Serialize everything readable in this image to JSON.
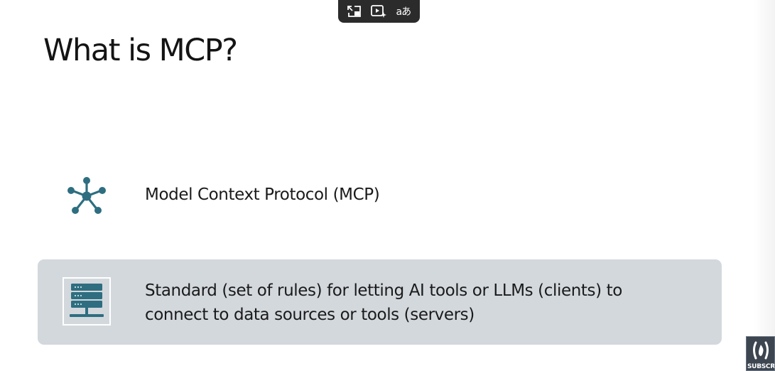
{
  "slide": {
    "title": "What is MCP?",
    "bullet": {
      "icon": "hub-network-icon",
      "text": "Model Context Protocol (MCP)"
    },
    "highlight": {
      "icon": "server-icon",
      "lines": [
        "Standard (set of rules) for letting AI tools or LLMs (clients) to",
        "connect to data sources or tools (servers)"
      ]
    }
  },
  "overlay_toolbar": {
    "buttons": [
      {
        "name": "exit-picture-in-picture-button",
        "icon": "pip-exit-icon"
      },
      {
        "name": "video-assistant-button",
        "icon": "video-sparkle-icon"
      },
      {
        "name": "translate-button",
        "icon": "translate-icon",
        "glyph": "aあ"
      }
    ]
  },
  "subscribe_badge": {
    "icon": "freecodecamp-logo-icon",
    "label": "SUBSCRIBE"
  },
  "colors": {
    "accent_teal": "#2e6e80",
    "card_bg": "#d3d8dd",
    "title_text": "#141414",
    "toolbar_bg": "#2b2b2b",
    "badge_bg": "#3c4550"
  }
}
